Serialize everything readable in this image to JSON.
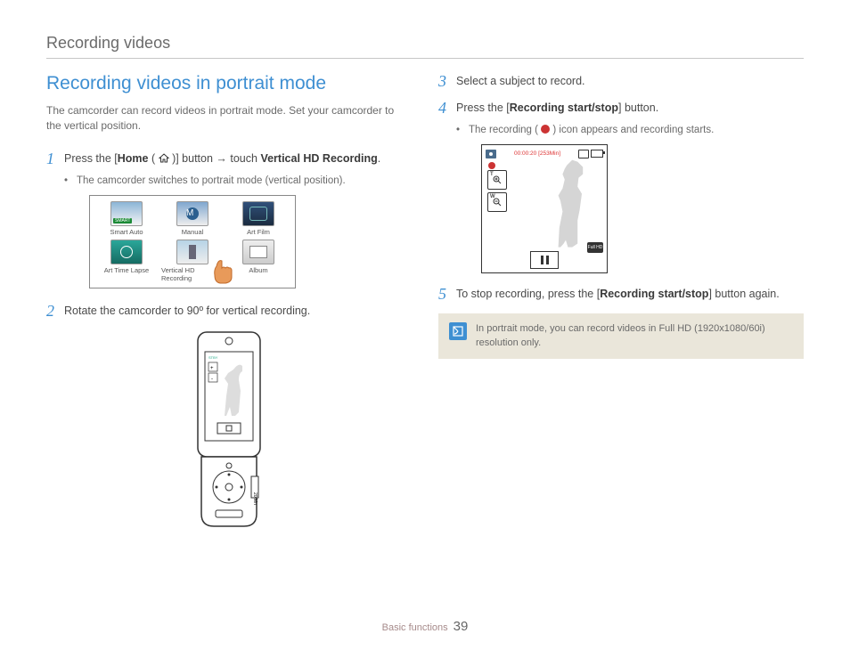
{
  "running_header": "Recording videos",
  "section_title": "Recording videos in portrait mode",
  "intro": "The camcorder can record videos in portrait mode. Set your camcorder to the vertical position.",
  "steps": {
    "1": {
      "num": "1",
      "pre": "Press the [",
      "bold1": "Home",
      "mid": " ( ",
      "post_icon": " )] button → touch ",
      "bold2": "Vertical HD Recording",
      "end": ".",
      "bullet": "The camcorder switches to portrait mode (vertical position)."
    },
    "2": {
      "num": "2",
      "text": "Rotate the camcorder to 90º for vertical recording."
    },
    "3": {
      "num": "3",
      "text": "Select a subject to record."
    },
    "4": {
      "num": "4",
      "pre": "Press the [",
      "bold": "Recording start/stop",
      "post": "] button.",
      "bullet_pre": "The recording ( ",
      "bullet_post": " ) icon appears and recording starts."
    },
    "5": {
      "num": "5",
      "pre": "To stop recording, press the [",
      "bold": "Recording start/stop",
      "post": "] button again."
    }
  },
  "menu": {
    "smart": "Smart Auto",
    "manual": "Manual",
    "artfilm": "Art Film",
    "timelapse": "Art Time Lapse",
    "vertical": "Vertical HD Recording",
    "album": "Album"
  },
  "portrait_screen": {
    "time": "00:00:20 [253Min]",
    "zoom_t": "T",
    "zoom_w": "W",
    "hd": "Full HD"
  },
  "note": "In portrait mode, you can record videos in Full HD (1920x1080/60i) resolution only.",
  "footer_section": "Basic functions",
  "footer_page": "39"
}
